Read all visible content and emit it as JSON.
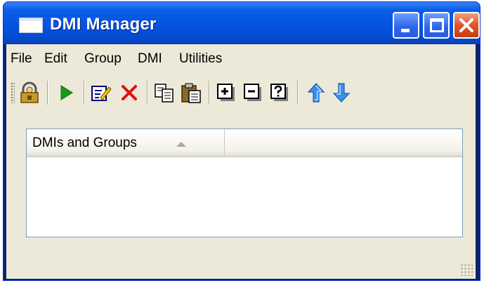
{
  "window": {
    "title": "DMI Manager"
  },
  "menu": {
    "items": [
      "File",
      "Edit",
      "Group",
      "DMI",
      "Utilities"
    ]
  },
  "toolbar": {
    "buttons": [
      {
        "icon": "security-icon"
      },
      {
        "icon": "run-icon",
        "color": "#1a9a1a"
      },
      {
        "icon": "edit-icon"
      },
      {
        "icon": "delete-icon",
        "color": "#e01010"
      },
      {
        "icon": "copy-icon"
      },
      {
        "icon": "paste-icon"
      },
      {
        "icon": "expand-icon"
      },
      {
        "icon": "collapse-icon"
      },
      {
        "icon": "help-icon"
      },
      {
        "icon": "move-up-icon",
        "color": "#3a90e8"
      },
      {
        "icon": "move-down-icon",
        "color": "#3a90e8"
      }
    ]
  },
  "list": {
    "column_header": "DMIs and Groups",
    "sort": "ascending"
  }
}
